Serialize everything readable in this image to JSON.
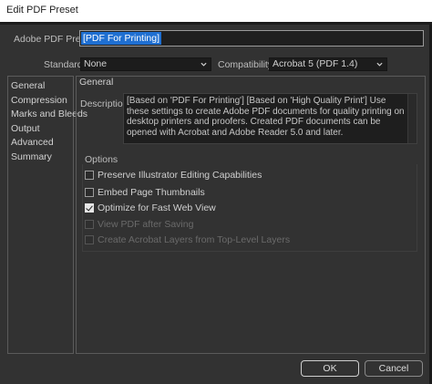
{
  "window": {
    "title": "Edit PDF Preset"
  },
  "preset": {
    "label": "Adobe PDF Preset:",
    "value": "[PDF For Printing]"
  },
  "standard": {
    "label": "Standard:",
    "value": "None"
  },
  "compatibility": {
    "label": "Compatibility:",
    "value": "Acrobat 5 (PDF 1.4)"
  },
  "sidebar": {
    "items": [
      {
        "label": "General"
      },
      {
        "label": "Compression"
      },
      {
        "label": "Marks and Bleeds"
      },
      {
        "label": "Output"
      },
      {
        "label": "Advanced"
      },
      {
        "label": "Summary"
      }
    ]
  },
  "general": {
    "section_title": "General",
    "description_label": "Description:",
    "description_text": "[Based on 'PDF For Printing'] [Based on 'High Quality Print'] Use these settings to create Adobe PDF documents for quality printing on desktop printers and proofers. Created PDF documents can be opened with Acrobat and Adobe Reader 5.0 and later."
  },
  "options": {
    "title": "Options",
    "items": [
      {
        "label": "Preserve Illustrator Editing Capabilities",
        "checked": false,
        "enabled": true
      },
      {
        "label": "Embed Page Thumbnails",
        "checked": false,
        "enabled": true
      },
      {
        "label": "Optimize for Fast Web View",
        "checked": true,
        "enabled": true
      },
      {
        "label": "View PDF after Saving",
        "checked": false,
        "enabled": false
      },
      {
        "label": "Create Acrobat Layers from Top-Level Layers",
        "checked": false,
        "enabled": false
      }
    ]
  },
  "buttons": {
    "ok": "OK",
    "cancel": "Cancel"
  },
  "colors": {
    "background": "#323232",
    "selection": "#1f6fd1",
    "field": "#1c1c1c"
  }
}
